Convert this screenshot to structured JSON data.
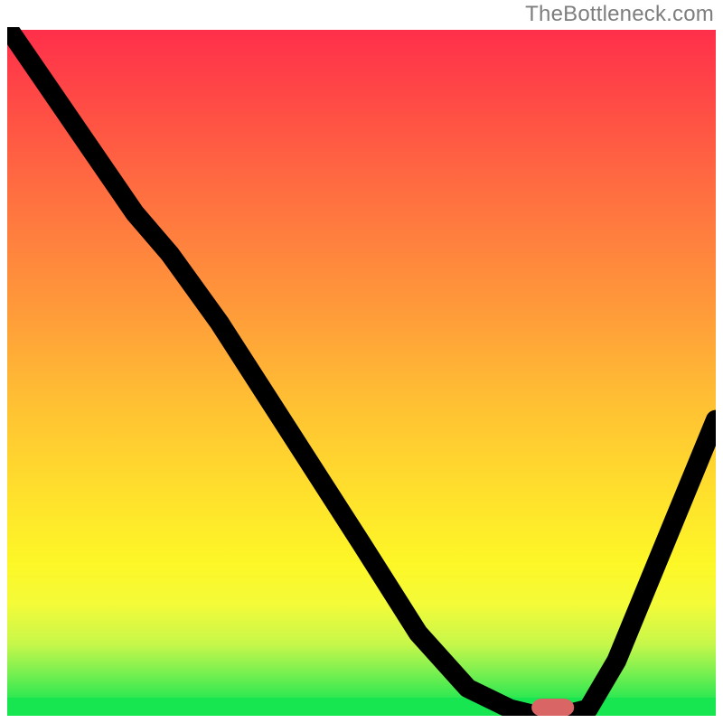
{
  "watermark": "TheBottleneck.com",
  "colors": {
    "gradient_top": "#ff2e4b",
    "gradient_bottom": "#17e651",
    "curve": "#000000",
    "marker": "#d96565",
    "watermark": "#7e7e7e"
  },
  "chart_data": {
    "type": "line",
    "title": "",
    "xlabel": "",
    "ylabel": "",
    "xlim": [
      0,
      100
    ],
    "ylim": [
      0,
      100
    ],
    "x": [
      0,
      6,
      12,
      18,
      23,
      30,
      40,
      50,
      58,
      65,
      71,
      75,
      78,
      82,
      86,
      90,
      94,
      100
    ],
    "values": [
      100,
      91,
      82,
      73,
      67,
      57,
      41,
      25,
      12,
      4,
      1,
      0,
      0,
      1,
      8,
      18,
      28,
      43
    ],
    "optimal_x": 77,
    "optimal_width": 5,
    "annotations": []
  }
}
